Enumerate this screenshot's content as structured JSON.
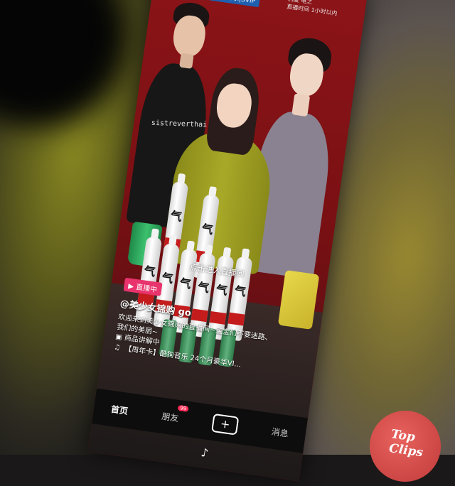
{
  "header": {
    "logo_text": "酷狗音乐|SVIP",
    "info_line1": "热度 电之",
    "info_line2": "直播时间 1小时以内"
  },
  "shirt_text": "sistreverthai",
  "bottle_label": "气",
  "overlay": {
    "enter_live": "点击进入直播间",
    "live_badge": "直播中",
    "username": "@美少女锦购 go",
    "description": "欢迎来到美少女锦购的直播间~宝宝们不要迷路、我们的美丽~",
    "product_line": "商品讲解中",
    "music": "【周年卡】酷狗音乐 24个月豪华VI..."
  },
  "navbar": {
    "items": [
      {
        "label": "首页",
        "active": true
      },
      {
        "label": "朋友",
        "badge": "99"
      },
      {
        "label": "+"
      },
      {
        "label": "消息"
      }
    ]
  },
  "watermark": "Top Clips",
  "icons": [
    "music-note-icon",
    "plus-icon",
    "tiktok-logo-icon",
    "live-tv-icon"
  ],
  "colors": {
    "wall": "#7a1013",
    "live_badge": "#e8336d",
    "nav_badge": "#ff2b55",
    "top_clips": "#c03a3a"
  }
}
